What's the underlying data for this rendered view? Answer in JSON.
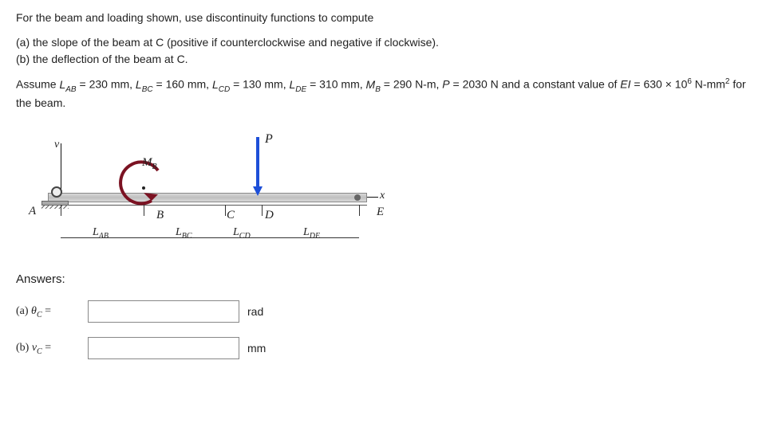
{
  "problem": {
    "intro": "For the beam and loading shown, use discontinuity functions to compute",
    "partA": "(a) the slope of the beam at C (positive if counterclockwise and negative if clockwise).",
    "partB": "(b) the deflection of the beam at C.",
    "assume_pre": "Assume ",
    "assume_vals": "L_AB = 230 mm, L_BC = 160 mm, L_CD = 130 mm, L_DE = 310 mm, M_B = 290 N-m, P = 2030 N and a constant value of EI = 630 × 10^6 N-mm^2 for the beam."
  },
  "diagram": {
    "P": "P",
    "MB": "M",
    "MBsub": "B",
    "v": "v",
    "x": "x",
    "A": "A",
    "B": "B",
    "C": "C",
    "D": "D",
    "E": "E",
    "LAB": "L",
    "LABsub": "AB",
    "LBC": "L",
    "LBCsub": "BC",
    "LCD": "L",
    "LCDsub": "CD",
    "LDE": "L",
    "LDEsub": "DE"
  },
  "answers": {
    "heading": "Answers:",
    "a_label_pre": "(a)  ",
    "a_sym": "θ",
    "a_sub": "C",
    "a_eq": " =",
    "a_unit": "rad",
    "b_label_pre": "(b)  ",
    "b_sym": "v",
    "b_sub": "C",
    "b_eq": " =",
    "b_unit": "mm"
  }
}
